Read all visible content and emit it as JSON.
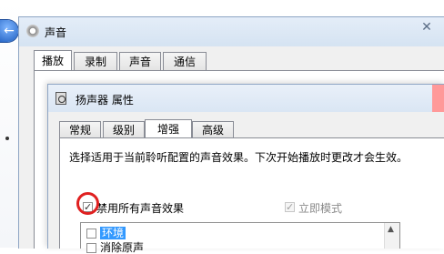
{
  "outer_window": {
    "title": "声音",
    "close_glyph": "✕",
    "tabs": [
      "播放",
      "录制",
      "声音",
      "通信"
    ],
    "active_tab": 0
  },
  "back_button_glyph": "←",
  "inner_window": {
    "title": "扬声器 属性",
    "tabs": [
      "常规",
      "级别",
      "增强",
      "高级"
    ],
    "active_tab": 2,
    "description": "选择适用于当前聆听配置的声音效果。下次开始播放时更改才会生效。",
    "disable_all": {
      "label": "禁用所有声音效果",
      "checked": true,
      "check_glyph": "✓"
    },
    "immediate_mode": {
      "label": "立即模式",
      "checked": true,
      "enabled": false,
      "check_glyph": "✓"
    },
    "effects": [
      {
        "label": "环境",
        "checked": false,
        "selected": true
      },
      {
        "label": "消除原声",
        "checked": false,
        "selected": false
      }
    ],
    "scroll_up_glyph": "▲"
  }
}
